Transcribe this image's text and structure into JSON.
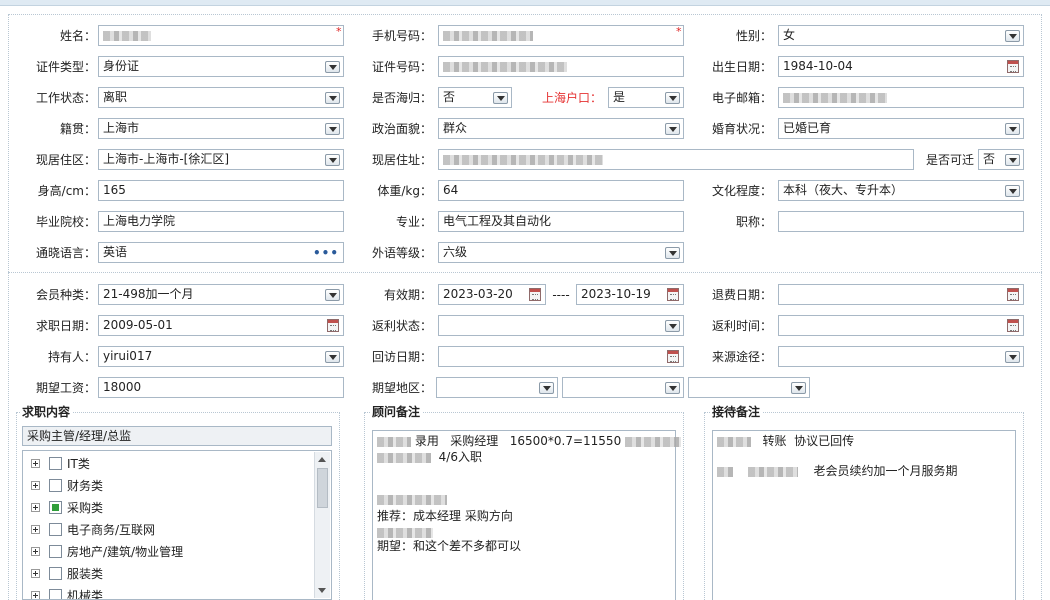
{
  "fields": {
    "name": {
      "label": "姓名：",
      "value": ""
    },
    "phone": {
      "label": "手机号码：",
      "value": ""
    },
    "gender": {
      "label": "性别：",
      "value": "女"
    },
    "id_type": {
      "label": "证件类型：",
      "value": "身份证"
    },
    "id_number": {
      "label": "证件号码：",
      "value": ""
    },
    "birth_date": {
      "label": "出生日期：",
      "value": "1984-10-04"
    },
    "work_status": {
      "label": "工作状态：",
      "value": "离职"
    },
    "returnee": {
      "label": "是否海归：",
      "value": "否"
    },
    "shanghai_hukou": {
      "label": "上海户口：",
      "value": "是"
    },
    "email": {
      "label": "电子邮箱：",
      "value": ""
    },
    "native_place": {
      "label": "籍贯：",
      "value": "上海市"
    },
    "political": {
      "label": "政治面貌：",
      "value": "群众"
    },
    "marital": {
      "label": "婚育状况：",
      "value": "已婚已育"
    },
    "residence_area": {
      "label": "现居住区：",
      "value": "上海市-上海市-[徐汇区]"
    },
    "address": {
      "label": "现居住址：",
      "value": ""
    },
    "relocatable": {
      "label": "是否可迁",
      "value": "否"
    },
    "height": {
      "label": "身高/cm：",
      "value": "165"
    },
    "weight": {
      "label": "体重/kg：",
      "value": "64"
    },
    "education": {
      "label": "文化程度：",
      "value": "本科（夜大、专升本）"
    },
    "school": {
      "label": "毕业院校：",
      "value": "上海电力学院"
    },
    "major": {
      "label": "专业：",
      "value": "电气工程及其自动化"
    },
    "title": {
      "label": "职称：",
      "value": ""
    },
    "language": {
      "label": "通晓语言：",
      "value": "英语"
    },
    "foreign_level": {
      "label": "外语等级：",
      "value": "六级"
    },
    "member_type": {
      "label": "会员种类：",
      "value": "21-498加一个月"
    },
    "validity": {
      "label": "有效期：",
      "from": "2023-03-20",
      "sep": "----",
      "to": "2023-10-19"
    },
    "refund_date": {
      "label": "退费日期：",
      "value": ""
    },
    "job_date": {
      "label": "求职日期：",
      "value": "2009-05-01"
    },
    "rebate_status": {
      "label": "返利状态：",
      "value": ""
    },
    "rebate_time": {
      "label": "返利时间：",
      "value": ""
    },
    "holder": {
      "label": "持有人：",
      "value": "yirui017"
    },
    "visit_date": {
      "label": "回访日期：",
      "value": ""
    },
    "source": {
      "label": "来源途径：",
      "value": ""
    },
    "salary": {
      "label": "期望工资：",
      "value": "18000"
    },
    "region": {
      "label": "期望地区：",
      "v1": "",
      "v2": "",
      "v3": ""
    }
  },
  "job_panel": {
    "title": "求职内容",
    "selected": "采购主管/经理/总监",
    "tree": [
      {
        "label": "IT类",
        "checked": false
      },
      {
        "label": "财务类",
        "checked": false
      },
      {
        "label": "采购类",
        "checked": true
      },
      {
        "label": "电子商务/互联网",
        "checked": false
      },
      {
        "label": "房地产/建筑/物业管理",
        "checked": false
      },
      {
        "label": "服装类",
        "checked": false
      },
      {
        "label": "机械类",
        "checked": false
      }
    ]
  },
  "consultant_panel": {
    "title": "顾问备注",
    "line1": "录用   采购经理   16500*0.7=11550",
    "line2": "4/6入职",
    "line3": "推荐：成本经理 采购方向",
    "line4": "期望：和这个差不多都可以"
  },
  "reception_panel": {
    "title": "接待备注",
    "line1": "转账  协议已回传",
    "line2": "老会员续约加一个月服务期"
  },
  "required_mark": "*"
}
